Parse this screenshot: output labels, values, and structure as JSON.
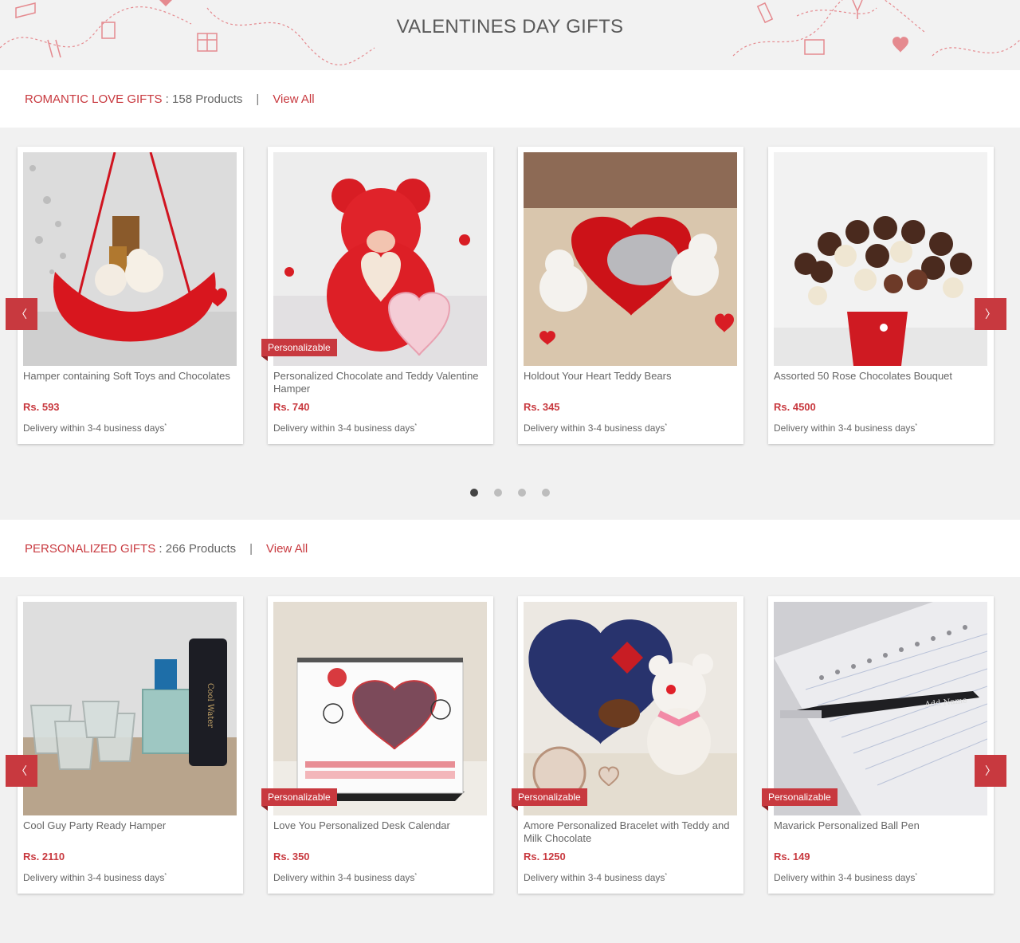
{
  "banner": {
    "title": "VALENTINES DAY GIFTS"
  },
  "theme": {
    "accent": "#c8393f",
    "background": "#f1f1f1"
  },
  "sections": [
    {
      "title": "ROMANTIC LOVE GIFTS",
      "count": "158 Products",
      "view_all": "View All",
      "products": [
        {
          "name": "Hamper containing Soft Toys and Chocolates",
          "price": "Rs. 593",
          "delivery": "Delivery within 3-4 business days",
          "personalizable": false
        },
        {
          "name": "Personalized Chocolate and Teddy Valentine Hamper",
          "price": "Rs. 740",
          "delivery": "Delivery within 3-4 business days",
          "personalizable": true,
          "badge": "Personalizable"
        },
        {
          "name": "Holdout Your Heart Teddy Bears",
          "price": "Rs. 345",
          "delivery": "Delivery within 3-4 business days",
          "personalizable": false
        },
        {
          "name": "Assorted 50 Rose Chocolates Bouquet",
          "price": "Rs. 4500",
          "delivery": "Delivery within 3-4 business days",
          "personalizable": false
        }
      ],
      "pagination": {
        "pages": 4,
        "active": 1
      }
    },
    {
      "title": "PERSONALIZED GIFTS",
      "count": "266 Products",
      "view_all": "View All",
      "products": [
        {
          "name": "Cool Guy Party Ready Hamper",
          "price": "Rs. 2110",
          "delivery": "Delivery within 3-4 business days",
          "personalizable": false
        },
        {
          "name": "Love You Personalized Desk Calendar",
          "price": "Rs. 350",
          "delivery": "Delivery within 3-4 business days",
          "personalizable": true,
          "badge": "Personalizable"
        },
        {
          "name": "Amore Personalized Bracelet with Teddy and Milk Chocolate",
          "price": "Rs. 1250",
          "delivery": "Delivery within 3-4 business days",
          "personalizable": true,
          "badge": "Personalizable"
        },
        {
          "name": "Mavarick Personalized Ball Pen",
          "price": "Rs. 149",
          "delivery": "Delivery within 3-4 business days",
          "personalizable": true,
          "badge": "Personalizable"
        }
      ]
    }
  ],
  "ui": {
    "prev_glyph": "〈",
    "next_glyph": "〉",
    "asterisk": "*"
  },
  "images": {
    "sec0_p0": "red-swing-hamper-teddy-chocolates-image",
    "sec0_p1": "red-teddy-bear-heart-frame-image",
    "sec0_p2": "teddy-bears-love-you-heart-image",
    "sec0_p3": "rose-chocolates-bouquet-image",
    "sec1_p0": "shot-glasses-perfume-deodorant-image",
    "sec1_p1": "love-you-desk-calendar-image",
    "sec1_p2": "almonds-heart-box-teddy-bracelet-image",
    "sec1_p3": "black-ball-pen-on-notebook-image"
  }
}
